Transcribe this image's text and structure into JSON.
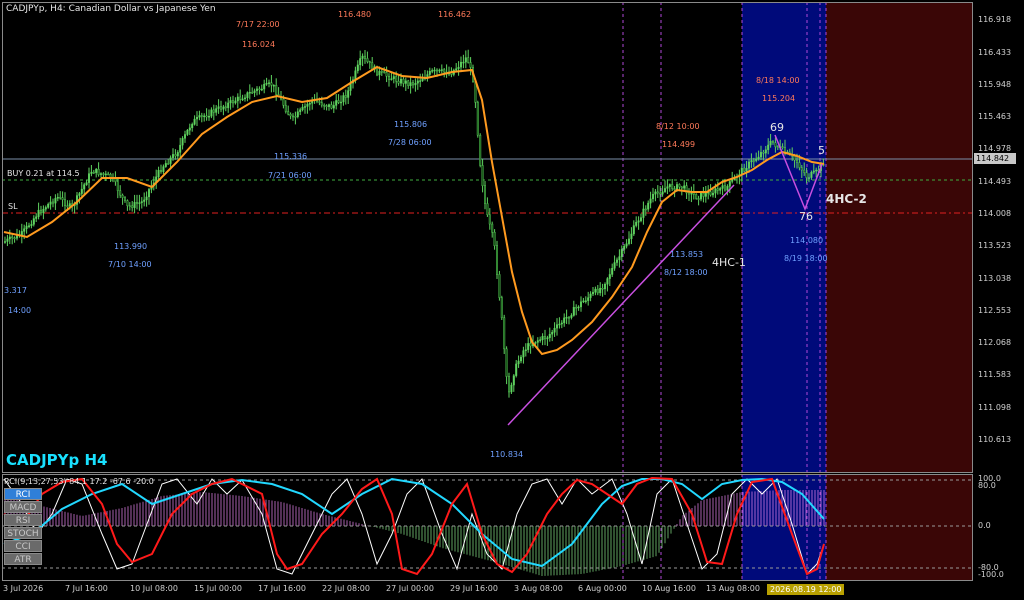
{
  "header": {
    "symbol_info": "CADJPYp, H4:  Canadian Dollar vs Japanese Yen",
    "big_label": "CADJPYp H4"
  },
  "trade": {
    "buy_label": "BUY 0.21 at 114.5",
    "sl_label": "SL",
    "current_price": "114.842"
  },
  "price_axis": [
    "116.918",
    "116.433",
    "115.948",
    "115.463",
    "114.978",
    "114.493",
    "114.008",
    "113.523",
    "113.038",
    "112.553",
    "112.068",
    "111.583",
    "111.098",
    "110.613"
  ],
  "time_axis": [
    "3 Jul 2026",
    "7 Jul 16:00",
    "10 Jul 08:00",
    "15 Jul 00:00",
    "17 Jul 16:00",
    "22 Jul 08:00",
    "27 Jul 00:00",
    "29 Jul 16:00",
    "3 Aug 08:00",
    "6 Aug 00:00",
    "10 Aug 16:00",
    "13 Aug 08:00"
  ],
  "time_highlight": "2026.08.19 12:00",
  "annotations": {
    "a1_price": "3.317",
    "a1_time": "14:00",
    "a2_price": "113.990",
    "a2_time": "7/10 14:00",
    "a3_time": "7/17 22:00",
    "a3_price": "116.024",
    "a4_price": "115.336",
    "a4_time": "7/21 06:00",
    "a5_price": "116.480",
    "a6_price": "115.806",
    "a6_time": "7/28 06:00",
    "a7_price": "116.462",
    "a8_price": "110.834",
    "a9_time": "8/12 10:00",
    "a9_price": "114.499",
    "a10_price": "113.853",
    "a10_time": "8/12 18:00",
    "a11_time": "8/18 14:00",
    "a11_price": "115.204",
    "a12_price": "114.080",
    "a12_time": "8/19 18:00"
  },
  "pattern": {
    "label_1": "4HC-1",
    "label_2": "4HC-2",
    "n69": "69",
    "n5": "5",
    "n76": "76"
  },
  "indicator": {
    "title": "RCI(9,13,27,53) 84.1 17.2 -67.6 -20.0",
    "axis": [
      "100.0",
      "80.0",
      "0.0",
      "-80.0",
      "-100.0"
    ],
    "tabs": [
      "RCI",
      "MACD",
      "RSI",
      "STOCH",
      "CCI",
      "ATR"
    ],
    "active_tab": "RCI"
  },
  "colors": {
    "background": "#000000",
    "up_candle": "#5fd35f",
    "ma": "#ff9a1f",
    "trendline": "#c84fe0",
    "highlight_blue": "#000a7a",
    "future_zone": "#3a0606",
    "rci_red": "#ff1a1a",
    "rci_cyan": "#22d8ff",
    "rci_white": "#ffffff",
    "label_cyan": "#19e1ff"
  }
}
